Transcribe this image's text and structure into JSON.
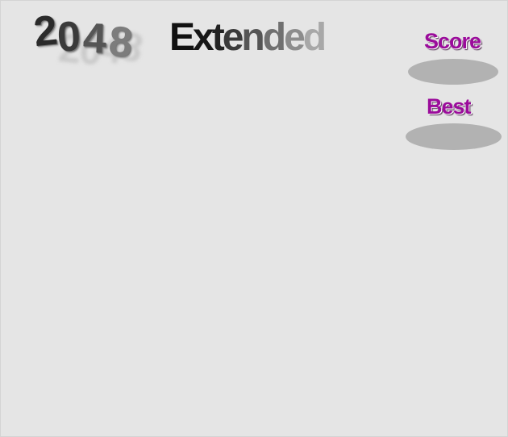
{
  "logo": {
    "digits": [
      "2",
      "0",
      "4",
      "8"
    ],
    "front_colors": [
      "#2b2b2b",
      "#3a3a3a",
      "#555555",
      "#7c7c7c"
    ]
  },
  "title": {
    "letters": [
      "E",
      "x",
      "t",
      "e",
      "n",
      "d",
      "e",
      "d"
    ],
    "colors": [
      "#111111",
      "#161616",
      "#222222",
      "#3a3a3a",
      "#555555",
      "#707070",
      "#8c8c8c",
      "#a8a8a8"
    ]
  },
  "score": {
    "label": "Score",
    "value": "",
    "label_color": "#9b0c9b"
  },
  "best": {
    "label": "Best",
    "value": "",
    "label_color": "#9b0c9b"
  },
  "colors": {
    "background": "#e5e5e5",
    "stat_bubble": "#b2b2b2"
  }
}
